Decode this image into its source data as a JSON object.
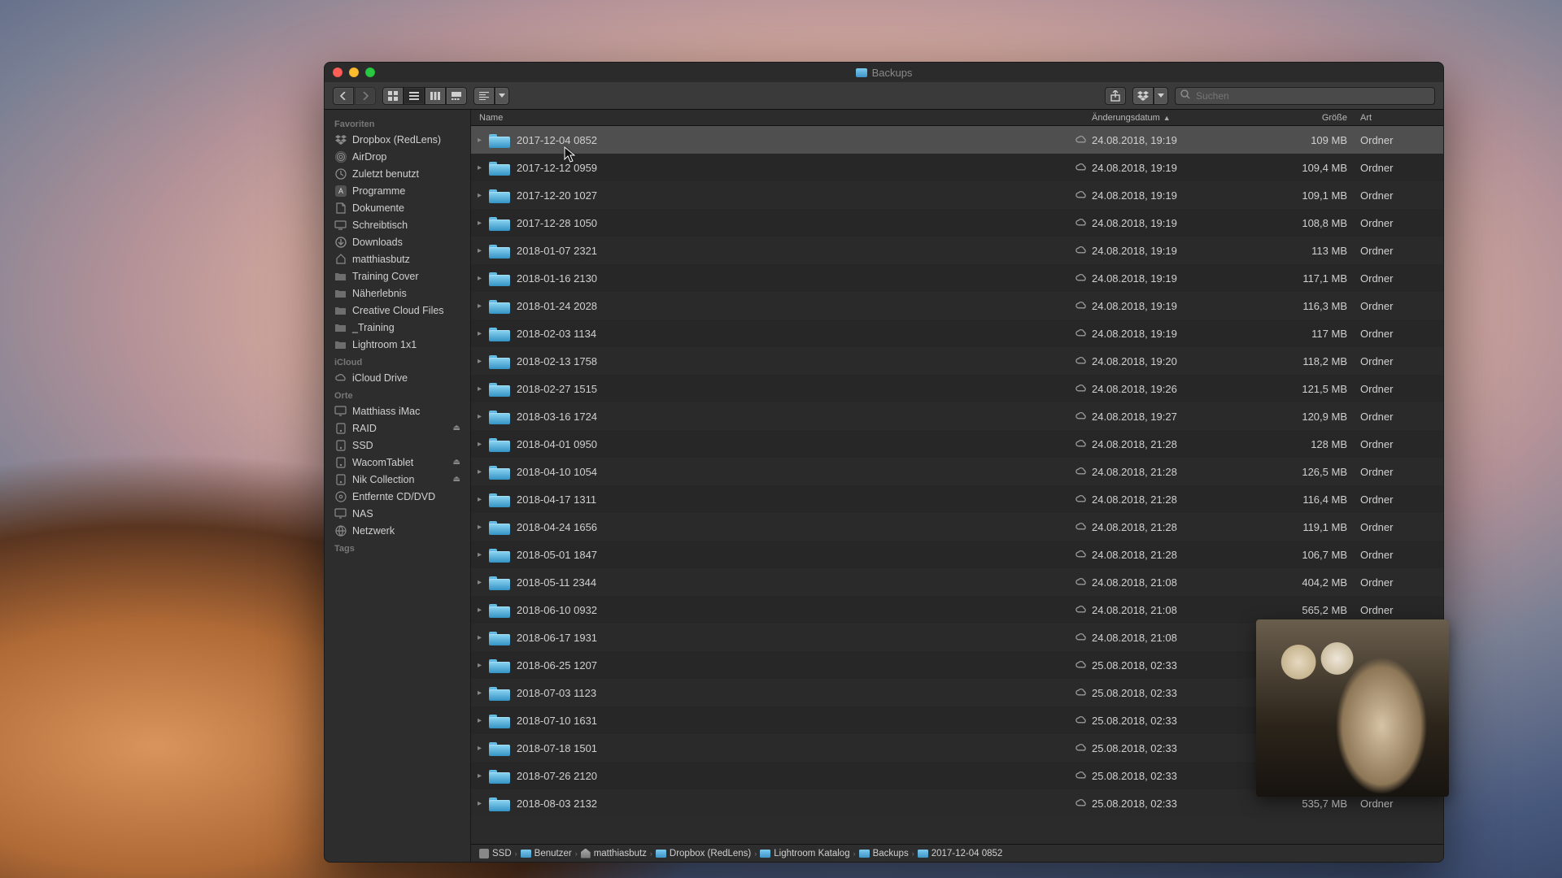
{
  "window": {
    "title": "Backups"
  },
  "toolbar": {
    "search_placeholder": "Suchen"
  },
  "sidebar": {
    "sections": [
      {
        "title": "Favoriten",
        "items": [
          {
            "label": "Dropbox (RedLens)",
            "icon": "dropbox"
          },
          {
            "label": "AirDrop",
            "icon": "airdrop"
          },
          {
            "label": "Zuletzt benutzt",
            "icon": "clock"
          },
          {
            "label": "Programme",
            "icon": "apps"
          },
          {
            "label": "Dokumente",
            "icon": "doc"
          },
          {
            "label": "Schreibtisch",
            "icon": "desk"
          },
          {
            "label": "Downloads",
            "icon": "dl"
          },
          {
            "label": "matthiasbutz",
            "icon": "home"
          },
          {
            "label": "Training Cover",
            "icon": "folder"
          },
          {
            "label": "Näherlebnis",
            "icon": "folder"
          },
          {
            "label": "Creative Cloud Files",
            "icon": "folder"
          },
          {
            "label": "_Training",
            "icon": "folder"
          },
          {
            "label": "Lightroom 1x1",
            "icon": "folder"
          }
        ]
      },
      {
        "title": "iCloud",
        "items": [
          {
            "label": "iCloud Drive",
            "icon": "cloud"
          }
        ]
      },
      {
        "title": "Orte",
        "items": [
          {
            "label": "Matthiass iMac",
            "icon": "comp"
          },
          {
            "label": "RAID",
            "icon": "disk",
            "eject": true
          },
          {
            "label": "SSD",
            "icon": "disk"
          },
          {
            "label": "WacomTablet",
            "icon": "disk",
            "eject": true
          },
          {
            "label": "Nik Collection",
            "icon": "disk",
            "eject": true
          },
          {
            "label": "Entfernte CD/DVD",
            "icon": "cd"
          },
          {
            "label": "NAS",
            "icon": "comp"
          },
          {
            "label": "Netzwerk",
            "icon": "net"
          }
        ]
      },
      {
        "title": "Tags",
        "items": []
      }
    ]
  },
  "columns": {
    "name": "Name",
    "date": "Änderungsdatum",
    "size": "Größe",
    "kind": "Art"
  },
  "rows": [
    {
      "name": "2017-12-04 0852",
      "cloud": true,
      "date": "24.08.2018, 19:19",
      "size": "109 MB",
      "kind": "Ordner",
      "selected": true
    },
    {
      "name": "2017-12-12 0959",
      "cloud": true,
      "date": "24.08.2018, 19:19",
      "size": "109,4 MB",
      "kind": "Ordner"
    },
    {
      "name": "2017-12-20 1027",
      "cloud": true,
      "date": "24.08.2018, 19:19",
      "size": "109,1 MB",
      "kind": "Ordner"
    },
    {
      "name": "2017-12-28 1050",
      "cloud": true,
      "date": "24.08.2018, 19:19",
      "size": "108,8 MB",
      "kind": "Ordner"
    },
    {
      "name": "2018-01-07 2321",
      "cloud": true,
      "date": "24.08.2018, 19:19",
      "size": "113 MB",
      "kind": "Ordner"
    },
    {
      "name": "2018-01-16 2130",
      "cloud": true,
      "date": "24.08.2018, 19:19",
      "size": "117,1 MB",
      "kind": "Ordner"
    },
    {
      "name": "2018-01-24 2028",
      "cloud": true,
      "date": "24.08.2018, 19:19",
      "size": "116,3 MB",
      "kind": "Ordner"
    },
    {
      "name": "2018-02-03 1134",
      "cloud": true,
      "date": "24.08.2018, 19:19",
      "size": "117 MB",
      "kind": "Ordner"
    },
    {
      "name": "2018-02-13 1758",
      "cloud": true,
      "date": "24.08.2018, 19:20",
      "size": "118,2 MB",
      "kind": "Ordner"
    },
    {
      "name": "2018-02-27 1515",
      "cloud": true,
      "date": "24.08.2018, 19:26",
      "size": "121,5 MB",
      "kind": "Ordner"
    },
    {
      "name": "2018-03-16 1724",
      "cloud": true,
      "date": "24.08.2018, 19:27",
      "size": "120,9 MB",
      "kind": "Ordner"
    },
    {
      "name": "2018-04-01 0950",
      "cloud": true,
      "date": "24.08.2018, 21:28",
      "size": "128 MB",
      "kind": "Ordner"
    },
    {
      "name": "2018-04-10 1054",
      "cloud": true,
      "date": "24.08.2018, 21:28",
      "size": "126,5 MB",
      "kind": "Ordner"
    },
    {
      "name": "2018-04-17 1311",
      "cloud": true,
      "date": "24.08.2018, 21:28",
      "size": "116,4 MB",
      "kind": "Ordner"
    },
    {
      "name": "2018-04-24 1656",
      "cloud": true,
      "date": "24.08.2018, 21:28",
      "size": "119,1 MB",
      "kind": "Ordner"
    },
    {
      "name": "2018-05-01 1847",
      "cloud": true,
      "date": "24.08.2018, 21:28",
      "size": "106,7 MB",
      "kind": "Ordner"
    },
    {
      "name": "2018-05-11 2344",
      "cloud": true,
      "date": "24.08.2018, 21:08",
      "size": "404,2 MB",
      "kind": "Ordner"
    },
    {
      "name": "2018-06-10 0932",
      "cloud": true,
      "date": "24.08.2018, 21:08",
      "size": "565,2 MB",
      "kind": "Ordner"
    },
    {
      "name": "2018-06-17 1931",
      "cloud": true,
      "date": "24.08.2018, 21:08",
      "size": "",
      "kind": ""
    },
    {
      "name": "2018-06-25 1207",
      "cloud": true,
      "date": "25.08.2018, 02:33",
      "size": "",
      "kind": ""
    },
    {
      "name": "2018-07-03 1123",
      "cloud": true,
      "date": "25.08.2018, 02:33",
      "size": "",
      "kind": ""
    },
    {
      "name": "2018-07-10 1631",
      "cloud": true,
      "date": "25.08.2018, 02:33",
      "size": "",
      "kind": ""
    },
    {
      "name": "2018-07-18 1501",
      "cloud": true,
      "date": "25.08.2018, 02:33",
      "size": "",
      "kind": ""
    },
    {
      "name": "2018-07-26 2120",
      "cloud": true,
      "date": "25.08.2018, 02:33",
      "size": "",
      "kind": ""
    },
    {
      "name": "2018-08-03 2132",
      "cloud": true,
      "date": "25.08.2018, 02:33",
      "size": "535,7 MB",
      "kind": "Ordner"
    }
  ],
  "pathbar": [
    {
      "label": "SSD",
      "icon": "disk"
    },
    {
      "label": "Benutzer",
      "icon": "folder"
    },
    {
      "label": "matthiasbutz",
      "icon": "home"
    },
    {
      "label": "Dropbox (RedLens)",
      "icon": "folder"
    },
    {
      "label": "Lightroom Katalog",
      "icon": "folder"
    },
    {
      "label": "Backups",
      "icon": "folder"
    },
    {
      "label": "2017-12-04 0852",
      "icon": "folder"
    }
  ]
}
